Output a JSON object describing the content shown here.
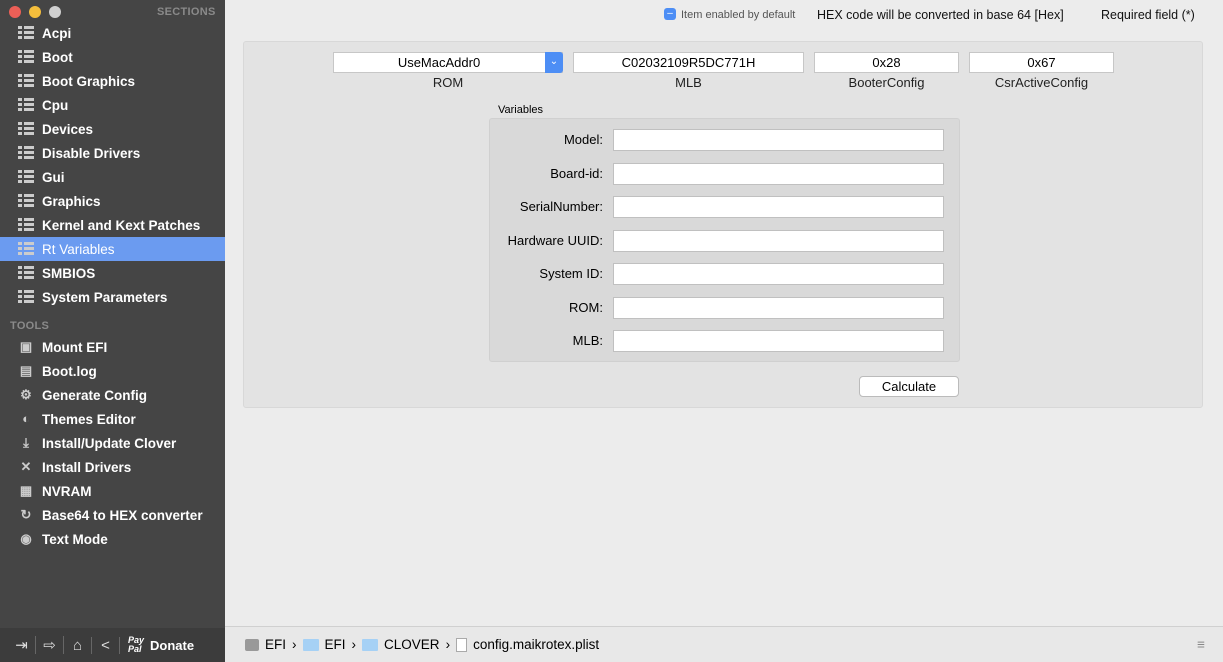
{
  "sidebar": {
    "sections_header": "SECTIONS",
    "sections": [
      "Acpi",
      "Boot",
      "Boot Graphics",
      "Cpu",
      "Devices",
      "Disable Drivers",
      "Gui",
      "Graphics",
      "Kernel and Kext Patches",
      "Rt Variables",
      "SMBIOS",
      "System Parameters"
    ],
    "selected": "Rt Variables",
    "tools_header": "TOOLS",
    "tools": [
      "Mount EFI",
      "Boot.log",
      "Generate Config",
      "Themes Editor",
      "Install/Update Clover",
      "Install Drivers",
      "NVRAM",
      "Base64 to HEX converter",
      "Text Mode"
    ],
    "paypal": "Pay Pal",
    "donate": "Donate"
  },
  "header": {
    "enabled_default": "Item enabled by default",
    "hex_note": "HEX code will be converted in base 64 [Hex]",
    "required": "Required field (*)"
  },
  "top_fields": {
    "rom_value": "UseMacAddr0",
    "rom_label": "ROM",
    "mlb_value": "C02032109R5DC771H",
    "mlb_label": "MLB",
    "booter_value": "0x28",
    "booter_label": "BooterConfig",
    "csr_value": "0x67",
    "csr_label": "CsrActiveConfig"
  },
  "variables": {
    "title": "Variables",
    "labels": [
      "Model:",
      "Board-id:",
      "SerialNumber:",
      "Hardware UUID:",
      "System ID:",
      "ROM:",
      "MLB:"
    ]
  },
  "calculate": "Calculate",
  "path": [
    "EFI",
    "EFI",
    "CLOVER",
    "config.maikrotex.plist"
  ],
  "colors": {
    "sidebar": "#454545",
    "selected": "#6b9bf0"
  }
}
